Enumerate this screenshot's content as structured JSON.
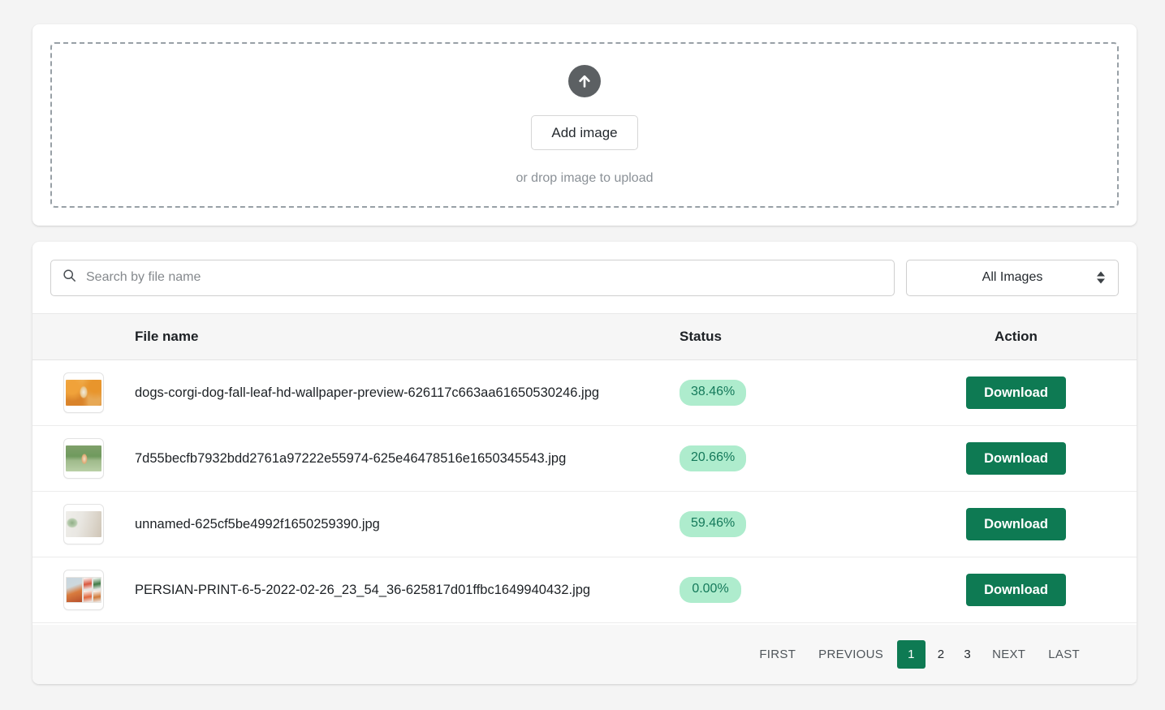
{
  "upload": {
    "icon": "upload-arrow-icon",
    "button_label": "Add image",
    "hint": "or drop image to upload"
  },
  "filters": {
    "search": {
      "icon": "search-icon",
      "value": "",
      "placeholder": "Search by file name"
    },
    "image_filter": {
      "selected": "All Images",
      "options": [
        "All Images"
      ]
    }
  },
  "table": {
    "headers": {
      "thumbnail": "",
      "file_name": "File name",
      "status": "Status",
      "action": "Action"
    },
    "rows": [
      {
        "thumbnail": "corgi-dog-autumn-leaves-thumbnail",
        "file_name": "dogs-corgi-dog-fall-leaf-hd-wallpaper-preview-626117c663aa61650530246.jpg",
        "status": "38.46%",
        "action_label": "Download"
      },
      {
        "thumbnail": "dog-on-grass-thumbnail",
        "file_name": "7d55becfb7932bdd2761a97222e55974-625e46478516e1650345543.jpg",
        "status": "20.66%",
        "action_label": "Download"
      },
      {
        "thumbnail": "desk-notebook-plant-thumbnail",
        "file_name": "unnamed-625cf5be4992f1650259390.jpg",
        "status": "59.46%",
        "action_label": "Download"
      },
      {
        "thumbnail": "persian-print-dresses-thumbnail",
        "file_name": "PERSIAN-PRINT-6-5-2022-02-26_23_54_36-625817d01ffbc1649940432.jpg",
        "status": "0.00%",
        "action_label": "Download"
      }
    ]
  },
  "pagination": {
    "first": "FIRST",
    "previous": "PREVIOUS",
    "pages": [
      "1",
      "2",
      "3"
    ],
    "active_page": "1",
    "next": "NEXT",
    "last": "LAST"
  },
  "colors": {
    "accent_green": "#0e7a53",
    "badge_bg": "#aeeccd",
    "badge_text": "#14795a",
    "page_bg": "#f4f4f4",
    "card_bg": "#ffffff"
  }
}
